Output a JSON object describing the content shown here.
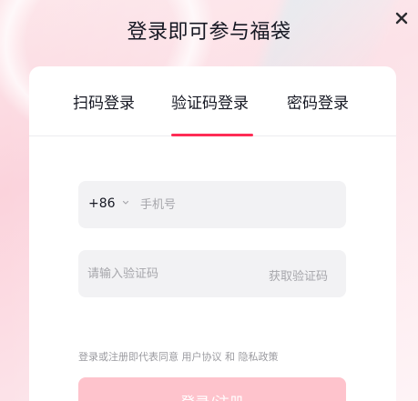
{
  "header": {
    "title": "登录即可参与福袋",
    "close_icon": "close-icon"
  },
  "tabs": [
    {
      "label": "扫码登录",
      "active": false
    },
    {
      "label": "验证码登录",
      "active": true
    },
    {
      "label": "密码登录",
      "active": false
    }
  ],
  "phone": {
    "country_code": "+86",
    "placeholder": "手机号",
    "value": ""
  },
  "verification": {
    "placeholder": "请输入验证码",
    "value": "",
    "get_code_label": "获取验证码"
  },
  "terms": {
    "prefix": "登录或注册即代表同意",
    "user_agreement": "用户协议",
    "and": "和",
    "privacy_policy": "隐私政策"
  },
  "submit": {
    "label": "登录/注册"
  },
  "colors": {
    "accent": "#fe2c55",
    "button_disabled": "#fec3cc",
    "field_bg": "#f2f2f4"
  }
}
